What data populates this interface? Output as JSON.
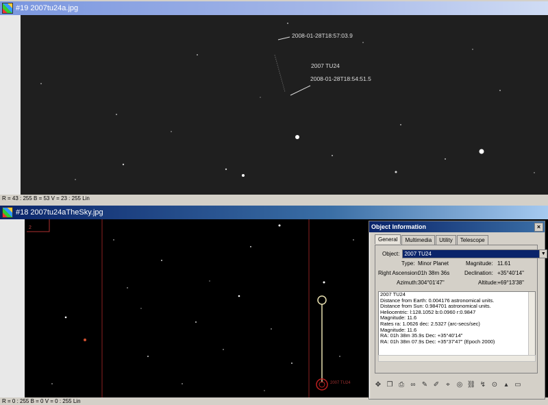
{
  "top_window": {
    "title": "#19 2007tu24a.jpg",
    "status": "R = 43 : 255   B = 53   V = 23 : 255 Lin",
    "annotations": {
      "time_top": "2008-01-28T18:57:03.9",
      "object_name": "2007 TU24",
      "time_bottom": "2008-01-28T18:54:51.5"
    }
  },
  "bottom_window": {
    "title": "#18 2007tu24aTheSky.jpg",
    "status": "R = 0 : 255   B = 0   V = 0 : 255 Lin",
    "marker_label": "2007 TU24"
  },
  "object_info": {
    "title": "Object Information",
    "close": "×",
    "tabs": [
      "General",
      "Multimedia",
      "Utility",
      "Telescope"
    ],
    "object_label": "Object:",
    "object_value": "2007 TU24",
    "type_label": "Type:",
    "type_value": "Minor Planet",
    "magnitude_label": "Magnitude:",
    "magnitude_value": "11.61",
    "ra_label": "Right Ascension:",
    "ra_value": "01h 38m 36s",
    "dec_label": "Declination:",
    "dec_value": "+35°40'14\"",
    "az_label": "Azimuth:",
    "az_value": "304°01'47\"",
    "alt_label": "Altitude:",
    "alt_value": "+69°13'38\"",
    "details": [
      "2007 TU24",
      "Distance from Earth: 0.004176  astronomical units.",
      "Distance from Sun:   0.984701  astronomical units.",
      "Heliocentric: l:128.1052 b:0.0960   r:0.9847",
      "Magnitude: 11.6",
      "Rates ra:   1.0626 dec:   2.5327 (arc-secs/sec)",
      "Magnitude: 11.6",
      "RA: 01h 38m 35.9s  Dec: +35°40'14\"",
      "RA: 01h 38m 07.9s  Dec: +35°37'47\"  (Epoch 2000)"
    ]
  }
}
